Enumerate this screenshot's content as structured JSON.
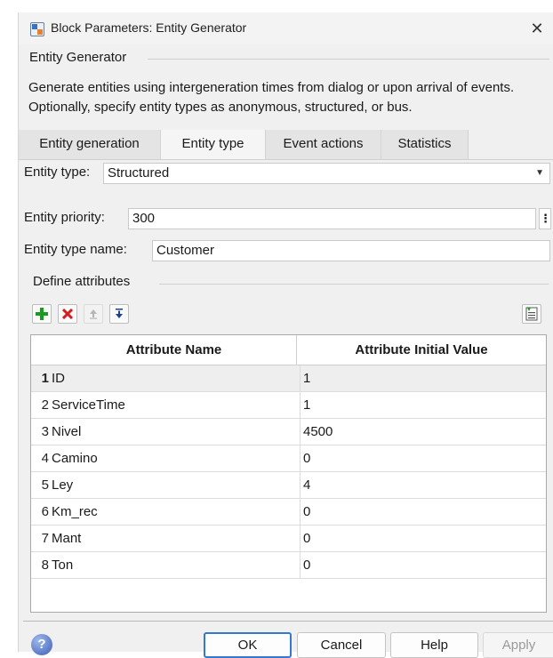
{
  "window": {
    "title": "Block Parameters: Entity Generator",
    "close_glyph": "✕"
  },
  "block": {
    "name": "Entity Generator",
    "description": "Generate entities using intergeneration times from dialog or upon arrival of events. Optionally, specify entity types as anonymous, structured, or bus."
  },
  "tabs": [
    {
      "label": "Entity generation",
      "active": false
    },
    {
      "label": "Entity type",
      "active": true
    },
    {
      "label": "Event actions",
      "active": false
    },
    {
      "label": "Statistics",
      "active": false
    }
  ],
  "form": {
    "entity_type_label": "Entity type:",
    "entity_type_value": "Structured",
    "entity_priority_label": "Entity priority:",
    "entity_priority_value": "300",
    "entity_type_name_label": "Entity type name:",
    "entity_type_name_value": "Customer"
  },
  "attributes": {
    "group_label": "Define attributes",
    "toolbar_icons": [
      "add-icon",
      "delete-icon",
      "move-up-icon",
      "move-down-icon",
      "import-icon"
    ],
    "columns": [
      "Attribute Name",
      "Attribute Initial Value"
    ],
    "rows": [
      {
        "num": "1",
        "name": "ID",
        "value": "1"
      },
      {
        "num": "2",
        "name": "ServiceTime",
        "value": "1"
      },
      {
        "num": "3",
        "name": "Nivel",
        "value": "4500"
      },
      {
        "num": "4",
        "name": "Camino",
        "value": "0"
      },
      {
        "num": "5",
        "name": "Ley",
        "value": "4"
      },
      {
        "num": "6",
        "name": "Km_rec",
        "value": "0"
      },
      {
        "num": "7",
        "name": "Mant",
        "value": "0"
      },
      {
        "num": "8",
        "name": "Ton",
        "value": "0"
      }
    ],
    "selected_row": 1
  },
  "buttons": {
    "ok": "OK",
    "cancel": "Cancel",
    "help": "Help",
    "apply": "Apply"
  },
  "colors": {
    "accent": "#3578d0",
    "add_green": "#1b9a22",
    "delete_red": "#d21f1f",
    "arrow_blue": "#1f3f8f"
  }
}
